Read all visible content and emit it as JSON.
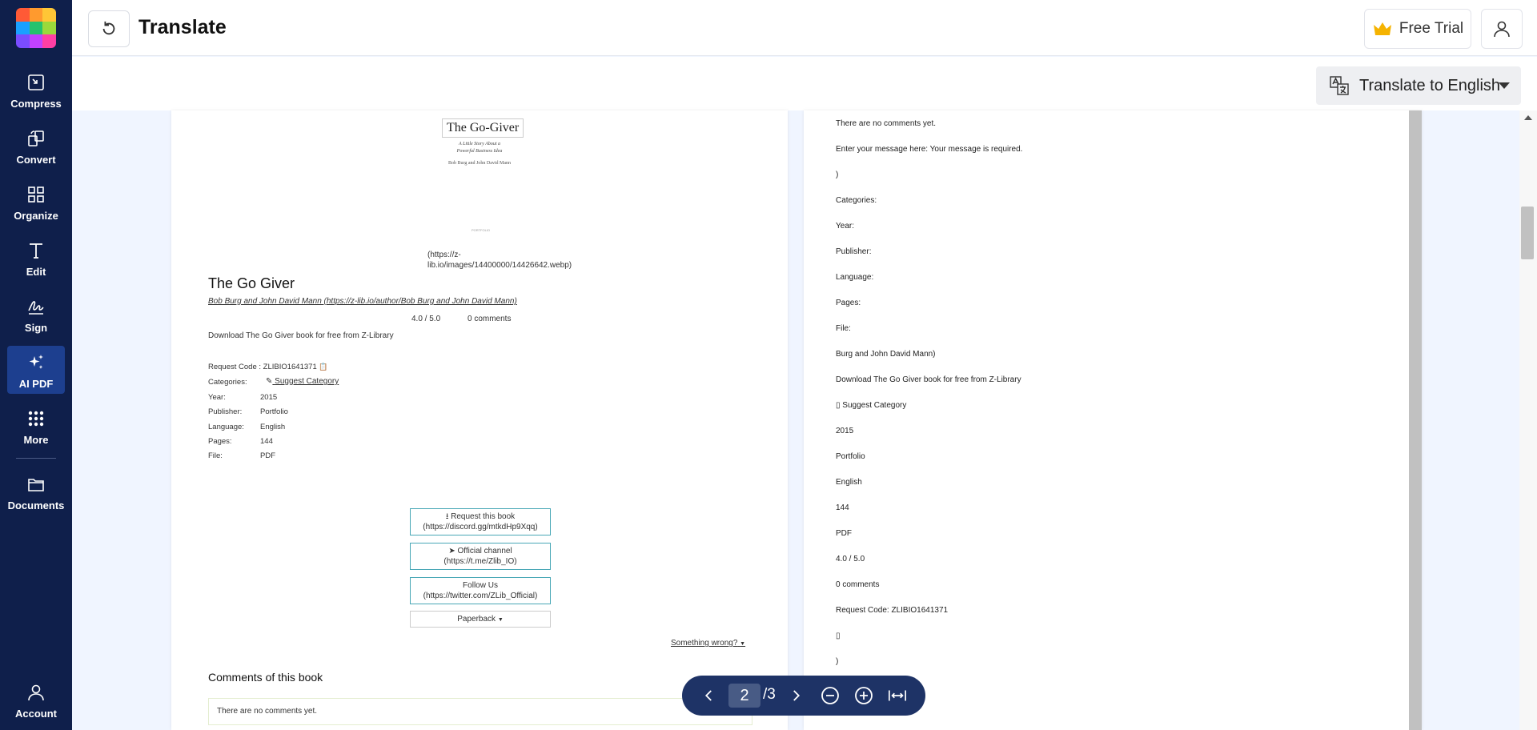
{
  "app": {
    "title": "Translate"
  },
  "sidebar": {
    "items": [
      {
        "key": "compress",
        "label": "Compress"
      },
      {
        "key": "convert",
        "label": "Convert"
      },
      {
        "key": "organize",
        "label": "Organize"
      },
      {
        "key": "edit",
        "label": "Edit"
      },
      {
        "key": "sign",
        "label": "Sign"
      },
      {
        "key": "ai_pdf",
        "label": "AI PDF"
      },
      {
        "key": "more",
        "label": "More"
      },
      {
        "key": "documents",
        "label": "Documents"
      },
      {
        "key": "account",
        "label": "Account"
      }
    ],
    "active": "ai_pdf"
  },
  "header": {
    "free_trial_label": "Free Trial"
  },
  "translate": {
    "button_label": "Translate to English"
  },
  "left_doc": {
    "cover_title": "The Go-Giver",
    "cover_subtitle": "A Little Story About a Powerful Business Idea",
    "cover_authors": "Bob Burg and John David Mann",
    "cover_publisher": "PORTFOLIO",
    "image_link": "(https://z-lib.io/images/14400000/14426642.webp)",
    "image_link_line1": "(https://z-",
    "image_link_line2": "lib.io/images/14400000/14426642.webp)",
    "book_title": "The Go Giver",
    "author_link": "Bob Burg and John David Mann (https://z-lib.io/author/Bob Burg and John David Mann)",
    "rating": "4.0 / 5.0",
    "comments_count": "0 comments",
    "download_text": "Download The Go Giver book for free from Z-Library",
    "request_code": "Request Code : ZLIBIO1641371",
    "categories_label": "Categories:",
    "suggest_category": "Suggest Category",
    "meta": [
      {
        "label": "Year:",
        "value": "2015"
      },
      {
        "label": "Publisher:",
        "value": "Portfolio"
      },
      {
        "label": "Language:",
        "value": "English"
      },
      {
        "label": "Pages:",
        "value": "144"
      },
      {
        "label": "File:",
        "value": "PDF"
      }
    ],
    "buttons": {
      "request_line1": "Request this book",
      "request_line2": "(https://discord.gg/mtkdHp9Xqq)",
      "channel_line1": "Official channel",
      "channel_line2": "(https://t.me/Zlib_IO)",
      "follow_line1": "Follow Us",
      "follow_line2": "(https://twitter.com/ZLib_Official)",
      "paperback": "Paperback"
    },
    "something_wrong": "Something wrong?",
    "comments_heading": "Comments of this book",
    "no_comments": "There are no comments yet."
  },
  "right_doc": {
    "lines": [
      "There are no comments yet.",
      "Enter your message here: Your message is required.",
      ")",
      "Categories:",
      "Year:",
      "Publisher:",
      "Language:",
      "Pages:",
      "File:",
      "Burg and John David Mann)",
      "Download The Go Giver book for free from Z-Library",
      "▯ Suggest Category",
      "2015",
      "Portfolio",
      "English",
      "144",
      "PDF",
      "4.0 / 5.0",
      "0 comments",
      "Request Code: ZLIBIO1641371",
      "▯",
      ")"
    ]
  },
  "pager": {
    "current_page": "2",
    "total": "/3"
  },
  "colors": {
    "sidebar_bg": "#0f1f4b",
    "sidebar_active": "#1d3f8f",
    "pager_bg": "#1e3366",
    "crown": "#f5b301"
  }
}
